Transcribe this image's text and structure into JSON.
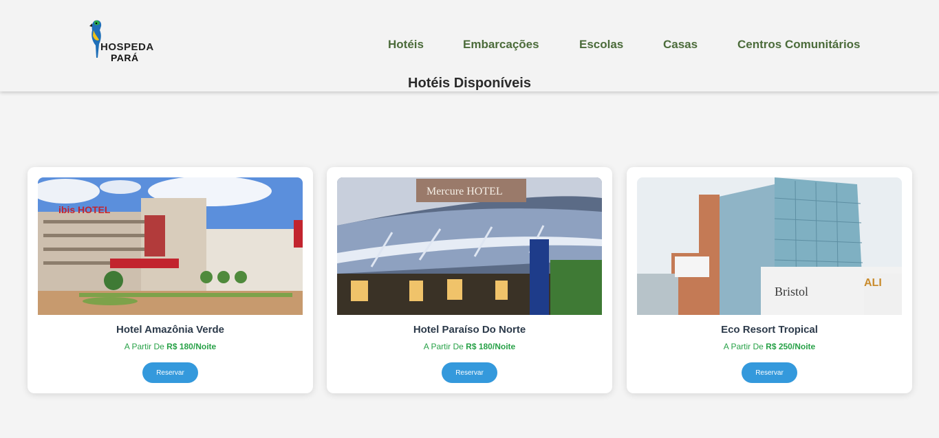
{
  "brand": {
    "line1": "HOSPEDA",
    "line2": "PARÁ"
  },
  "nav": [
    {
      "label": "Hotéis"
    },
    {
      "label": "Embarcações"
    },
    {
      "label": "Escolas"
    },
    {
      "label": "Casas"
    },
    {
      "label": "Centros Comunitários"
    }
  ],
  "page_title": "Hotéis Disponíveis",
  "price_prefix": "A Partir De",
  "price_suffix": "/Noite",
  "reserve_label": "Reservar",
  "hotels": [
    {
      "name": "Hotel Amazônia Verde",
      "price": "R$ 180",
      "photo_text": "ibis HOTEL"
    },
    {
      "name": "Hotel Paraíso Do Norte",
      "price": "R$ 180",
      "photo_text": "Mercure HOTEL"
    },
    {
      "name": "Eco Resort Tropical",
      "price": "R$ 250",
      "photo_text": "Bristol"
    }
  ],
  "colors": {
    "nav": "#4b6b3a",
    "price": "#27a147",
    "button": "#3499dc"
  }
}
